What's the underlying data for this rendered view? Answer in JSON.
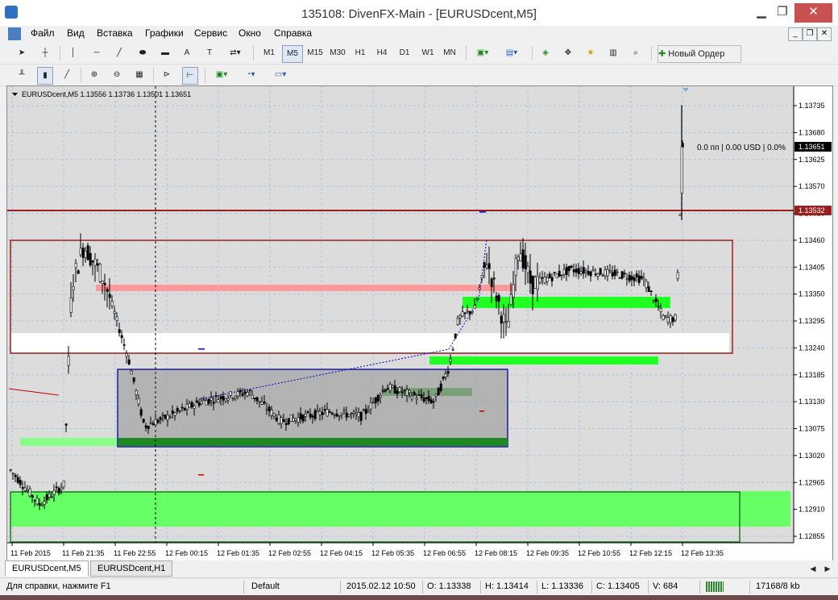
{
  "window": {
    "title": "135108: DivenFX-Main - [EURUSDcent,M5]"
  },
  "menu": [
    "Файл",
    "Вид",
    "Вставка",
    "Графики",
    "Сервис",
    "Окно",
    "Справка"
  ],
  "timeframes": [
    "M1",
    "M5",
    "M15",
    "M30",
    "H1",
    "H4",
    "D1",
    "W1",
    "MN"
  ],
  "toolbar": {
    "new_order": "Новый Ордер",
    "text_tool": "A"
  },
  "chart": {
    "header": "EURUSDcent,M5  1.13556 1.13736 1.13501 1.13651",
    "profit_label": "0.0 пп | 0.00 USD | 0.0%",
    "price_labels": [
      "1.13735",
      "1.13680",
      "1.13625",
      "1.13570",
      "1.13515",
      "1.13460",
      "1.13405",
      "1.13350",
      "1.13295",
      "1.13240",
      "1.13185",
      "1.13130",
      "1.13075",
      "1.13020",
      "1.12965",
      "1.12910",
      "1.12855"
    ],
    "current_price": "1.13651",
    "line_price": "1.13532",
    "time_labels": [
      "11 Feb 2015",
      "11 Feb 21:35",
      "11 Feb 22:55",
      "12 Feb 00:15",
      "12 Feb 01:35",
      "12 Feb 02:55",
      "12 Feb 04:15",
      "12 Feb 05:35",
      "12 Feb 06:55",
      "12 Feb 08:15",
      "12 Feb 09:35",
      "12 Feb 10:55",
      "12 Feb 12:15",
      "12 Feb 13:35"
    ],
    "colors": {
      "bg": "#dcdcdc",
      "grid": "#a9c6de",
      "box_red": "#9a1f1f",
      "box_blue": "#1a1aa0",
      "green": "#00ff00",
      "pink": "#ff9999",
      "dark_green": "#1f8a1f"
    }
  },
  "tabs": [
    "EURUSDcent,M5",
    "EURUSDcent,H1"
  ],
  "status": {
    "help": "Для справки, нажмите F1",
    "profile": "Default",
    "datetime": "2015.02.12 10:50",
    "open": "O: 1.13338",
    "high": "H: 1.13414",
    "low": "L: 1.13336",
    "close": "C: 1.13405",
    "volume": "V: 684",
    "traffic": "17168/8 kb"
  }
}
